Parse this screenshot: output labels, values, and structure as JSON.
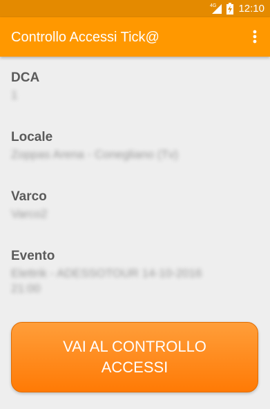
{
  "status_bar": {
    "network": "4G",
    "time": "12:10"
  },
  "app_bar": {
    "title": "Controllo Accessi Tick@",
    "overflow_icon": "more-vert-icon"
  },
  "fields": [
    {
      "label": "DCA",
      "value": "1"
    },
    {
      "label": "Locale",
      "value": "Zoppas Arena - Conegliano (Tv)"
    },
    {
      "label": "Varco",
      "value": "Varco2"
    },
    {
      "label": "Evento",
      "value": "Elettrik - ADESSOTOUR 14-10-2016 21:00"
    }
  ],
  "main_button": {
    "label": "VAI AL CONTROLLO ACCESSI"
  },
  "colors": {
    "status_bar": "#E48A00",
    "app_bar": "#FF9800",
    "button": "#FF8A1A",
    "background": "#EEEEEE"
  }
}
